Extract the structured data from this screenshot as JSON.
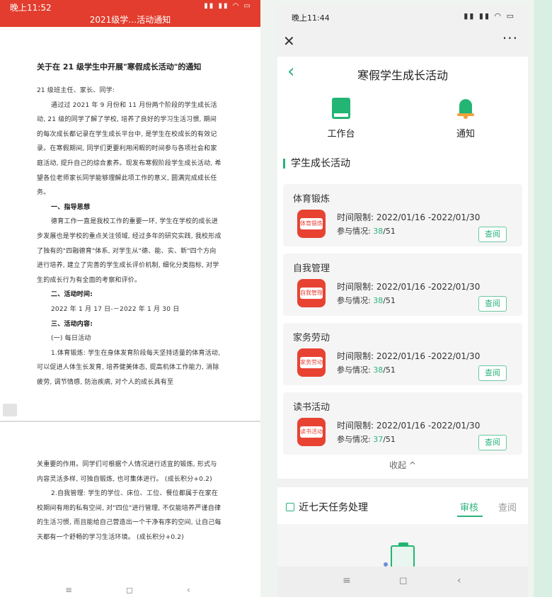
{
  "left": {
    "status_time": "晚上11:52",
    "status_icons": "▮▮ ▮▮ ◠ ▭",
    "doc_header": "2021级学…活动通知",
    "doc_title": "关于在 21 级学生中开展\"寒假成长活动\"的通知",
    "paragraphs": [
      {
        "text": "21 级班主任、家长、同学:",
        "bold": false,
        "indent": false
      },
      {
        "text": "通过过 2021 年 9 月份和 11 月份两个阶段的学生成长活动, 21 级的同学了解了学校, 培养了良好的学习生活习惯, 期间的每次成长都记录在学生成长平台中, 是学生在校成长的有效记录。在寒假期间, 同学们更要利用闲暇的时间参与各项社会和家庭活动, 提升自己的综合素养。现发布寒假阶段学生成长活动, 希望各位老师家长同学能够理解此项工作的意义, 圆满完成成长任务。",
        "bold": false,
        "indent": true
      },
      {
        "text": "一、指导思想",
        "bold": true,
        "indent": true
      },
      {
        "text": "德育工作一直是我校工作的重要一环, 学生在学校的成长进步发展也是学校的重点关注领域, 经过多年的研究实践, 我校形成了独有的\"四融德育\"体系, 对学生从\"德、能、实、新\"四个方向进行培养, 建立了完善的学生成长评价机制, 细化分类指标, 对学生的成长行为有全面的考察和评价。",
        "bold": false,
        "indent": true
      },
      {
        "text": "二、活动时间:",
        "bold": true,
        "indent": true
      },
      {
        "text": "2022 年 1 月 17 日-－2022 年 1 月 30 日",
        "bold": false,
        "indent": true
      },
      {
        "text": "三、活动内容:",
        "bold": true,
        "indent": true
      },
      {
        "text": "(一) 每日活动",
        "bold": false,
        "indent": true
      },
      {
        "text": "1.体育锻炼: 学生在身体发育阶段每天坚持适量的体育活动, 可以促进人体生长发育, 培养健美体态, 提高机体工作能力, 消除疲劳, 调节情感, 防治疾病, 对个人的成长具有至",
        "bold": false,
        "indent": true
      }
    ],
    "paragraphs2": [
      {
        "text": "关重要的作用。同学们可根据个人情况进行适宜的锻炼, 形式与内容灵活多样, 可独自锻炼, 也可集体进行。 (成长积分+0.2)",
        "bold": false,
        "indent": false
      },
      {
        "text": "2.自我管理: 学生的学位、床位、工位、餐位都属于在家在校期间有用的私有空间, 对\"四位\"进行管理, 不仅能培养严谨自律的生活习惯, 而且能给自己营造出一个干净有序的空间, 让自己每天都有一个舒畅的学习生活环境。 (成长积分+0.2)",
        "bold": false,
        "indent": true
      }
    ],
    "nav": {
      "menu": "≡",
      "home": "◻",
      "back": "‹"
    }
  },
  "right": {
    "status_time": "晚上11:44",
    "status_icons": "▮▮ ▮▮ ◠ ▭",
    "close_glyph": "✕",
    "more_glyph": "···",
    "back_glyph": "‹",
    "page_title": "寒假学生成长活动",
    "quick": [
      {
        "label": "工作台",
        "icon": "book-icon"
      },
      {
        "label": "通知",
        "icon": "bell-icon"
      }
    ],
    "section_title": "学生成长活动",
    "activities": [
      {
        "name": "体育锻炼",
        "thumb": "体育锻炼",
        "time": "时间限制: 2022/01/16 -2022/01/30",
        "part_label": "参与情况: ",
        "done": "38",
        "total": "/51",
        "button": "查阅"
      },
      {
        "name": "自我管理",
        "thumb": "自我管理",
        "time": "时间限制: 2022/01/16 -2022/01/30",
        "part_label": "参与情况: ",
        "done": "38",
        "total": "/51",
        "button": "查阅"
      },
      {
        "name": "家务劳动",
        "thumb": "家务劳动",
        "time": "时间限制: 2022/01/16 -2022/01/30",
        "part_label": "参与情况: ",
        "done": "38",
        "total": "/51",
        "button": "查阅"
      },
      {
        "name": "读书活动",
        "thumb": "读书活动",
        "time": "时间限制: 2022/01/16 -2022/01/30",
        "part_label": "参与情况: ",
        "done": "37",
        "total": "/51",
        "button": "查阅"
      }
    ],
    "collapse_label": "收起 ^",
    "tasks_title": "近七天任务处理",
    "tabs": [
      "审核",
      "查阅"
    ],
    "nav": {
      "menu": "≡",
      "home": "◻",
      "back": "‹"
    }
  },
  "colors": {
    "accent": "#2bb37b",
    "header_red": "#e23d2e",
    "thumb_red": "#e84233"
  }
}
